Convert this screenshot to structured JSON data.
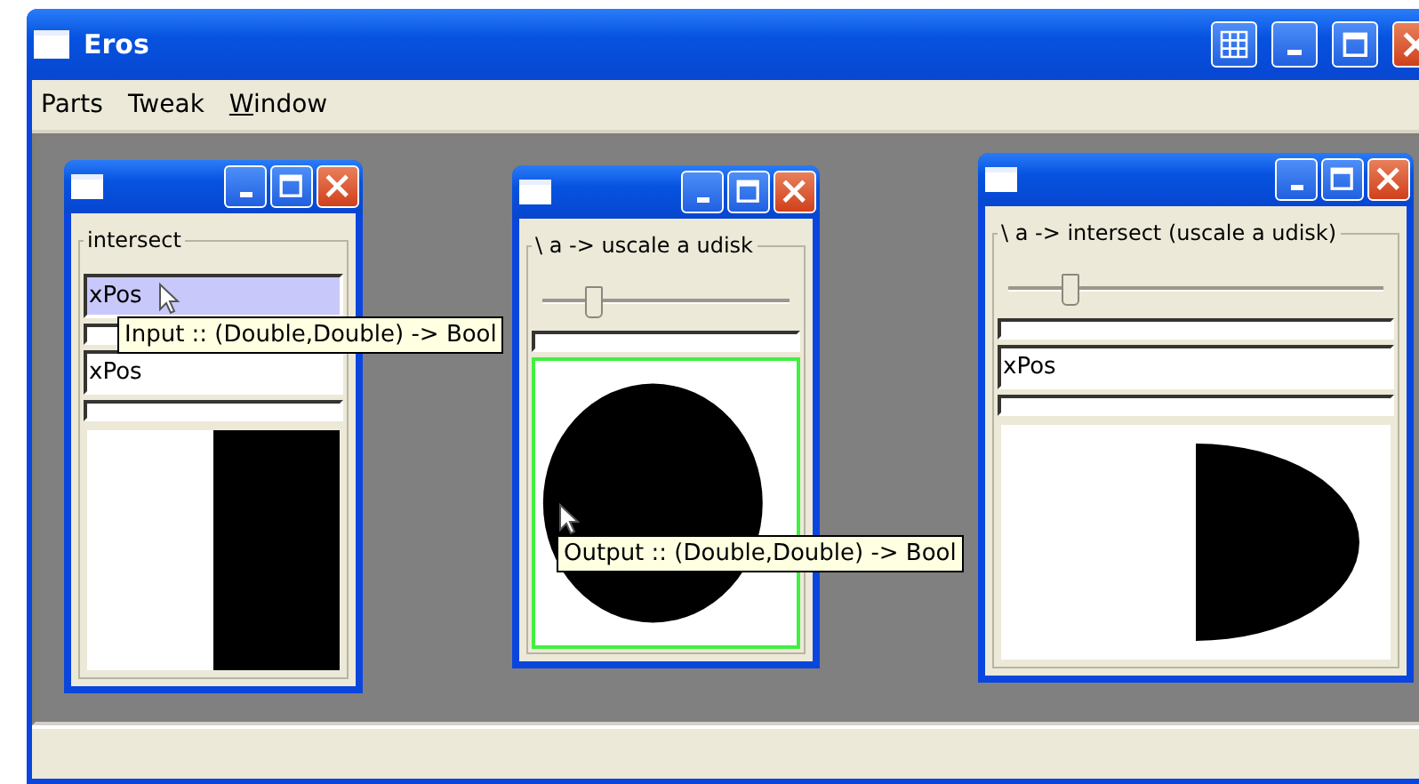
{
  "window": {
    "title": "Eros"
  },
  "menu": [
    {
      "label": "Parts",
      "mnemonic": false
    },
    {
      "label": "Tweak",
      "mnemonic": false
    },
    {
      "label": "Window",
      "mnemonic": true
    }
  ],
  "children": [
    {
      "group": "intersect",
      "controls": [
        {
          "kind": "field",
          "value": "xPos",
          "highlighted": true
        },
        {
          "kind": "field",
          "highlighted": false
        },
        {
          "kind": "field",
          "value": "xPos",
          "highlighted": false
        },
        {
          "kind": "field",
          "highlighted": false
        },
        {
          "kind": "halfplane",
          "outlined": false
        }
      ]
    },
    {
      "group": "\\ a -> uscale a udisk",
      "controls": [
        {
          "kind": "slider",
          "level": 0.2
        },
        {
          "kind": "field",
          "highlighted": false
        },
        {
          "kind": "disk",
          "outlined": true
        }
      ]
    },
    {
      "group": "\\ a -> intersect (uscale a udisk)",
      "controls": [
        {
          "kind": "slider",
          "level": 0.16
        },
        {
          "kind": "field",
          "highlighted": false
        },
        {
          "kind": "field",
          "value": "xPos",
          "highlighted": false
        },
        {
          "kind": "field",
          "highlighted": false
        },
        {
          "kind": "halfdisk",
          "outlined": false
        }
      ]
    }
  ],
  "tooltips": [
    {
      "text": "Input :: (Double,Double) -> Bool"
    },
    {
      "text": "Output :: (Double,Double) -> Bool"
    }
  ]
}
